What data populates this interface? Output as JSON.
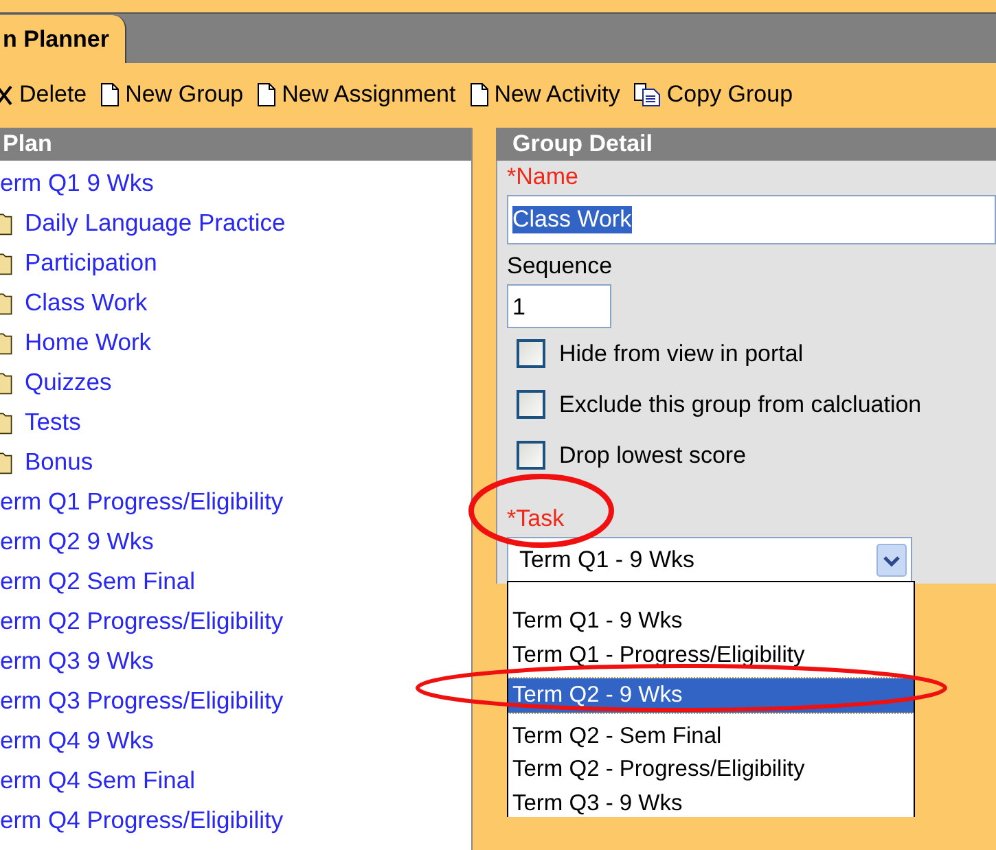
{
  "tab": {
    "label": "n Planner",
    "selected": true
  },
  "toolbar": [
    {
      "label": "Delete",
      "kind": "delete"
    },
    {
      "label": "New Group",
      "kind": "new"
    },
    {
      "label": "New Assignment",
      "kind": "new"
    },
    {
      "label": "New Activity",
      "kind": "new"
    },
    {
      "label": "Copy Group",
      "kind": "copy"
    }
  ],
  "plan": {
    "title": "Plan",
    "items": [
      {
        "label": "erm Q1 9 Wks",
        "children": [
          {
            "label": "Daily Language Practice"
          },
          {
            "label": "Participation"
          },
          {
            "label": "Class Work"
          },
          {
            "label": "Home Work"
          },
          {
            "label": "Quizzes"
          },
          {
            "label": "Tests"
          },
          {
            "label": "Bonus"
          }
        ]
      },
      {
        "label": "erm Q1 Progress/Eligibility"
      },
      {
        "label": "erm Q2 9 Wks"
      },
      {
        "label": "erm Q2 Sem Final"
      },
      {
        "label": "erm Q2 Progress/Eligibility"
      },
      {
        "label": "erm Q3 9 Wks"
      },
      {
        "label": "erm Q3 Progress/Eligibility"
      },
      {
        "label": "erm Q4 9 Wks"
      },
      {
        "label": "erm Q4 Sem Final"
      },
      {
        "label": "erm Q4 Progress/Eligibility"
      }
    ]
  },
  "group_detail": {
    "title": "Group Detail",
    "name": {
      "label": "*Name",
      "value": "Class Work"
    },
    "sequence": {
      "label": "Sequence",
      "value": "1"
    },
    "checkboxes": [
      {
        "label": "Hide from view in portal",
        "checked": false
      },
      {
        "label": "Exclude this group from calcluation",
        "checked": false
      },
      {
        "label": "Drop lowest score",
        "checked": false
      }
    ],
    "task": {
      "label": "*Task",
      "value": "Term Q1 - 9 Wks",
      "expanded": true,
      "options": [
        {
          "label": "Term Q1 - 9 Wks",
          "highlighted": false
        },
        {
          "label": "Term Q1 - Progress/Eligibility",
          "highlighted": false
        },
        {
          "label": "Term Q2 - 9 Wks",
          "highlighted": true
        },
        {
          "label": "Term Q2 - Sem Final",
          "highlighted": false
        },
        {
          "label": "Term Q2 - Progress/Eligibility",
          "highlighted": false
        },
        {
          "label": "Term Q3 - 9 Wks",
          "highlighted": false
        }
      ]
    }
  }
}
